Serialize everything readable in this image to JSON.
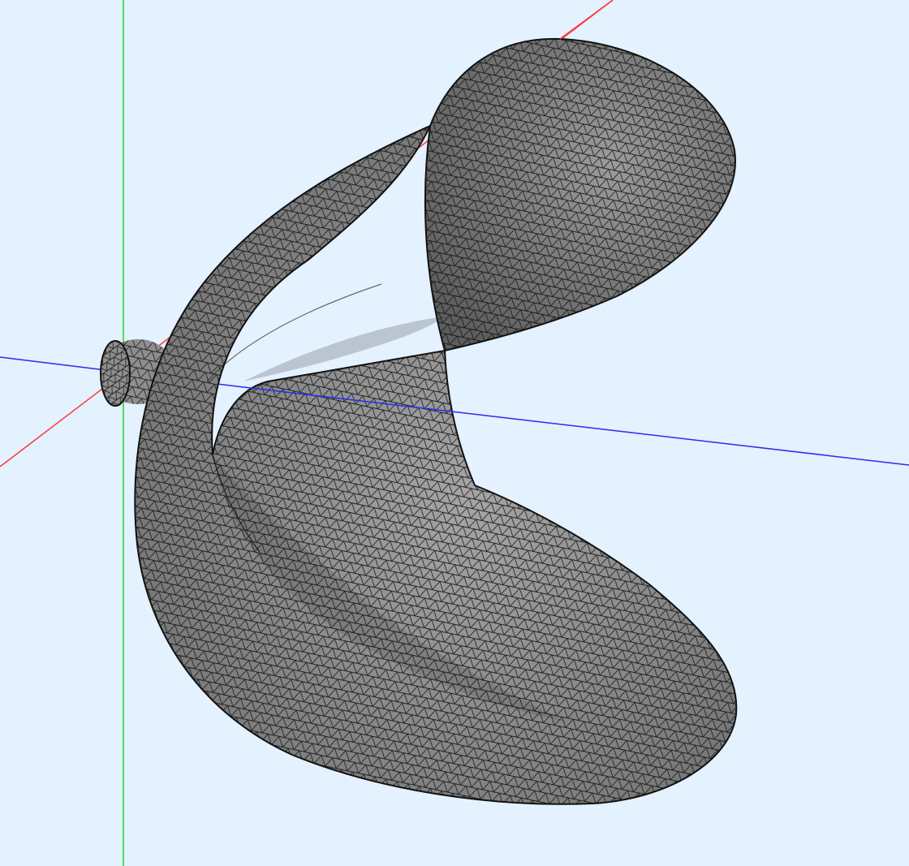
{
  "scene": {
    "background_color": "#e4f1ff",
    "mesh_fill_color": "#8e8e8e",
    "mesh_edge_color": "#111111",
    "axes": [
      {
        "name": "x",
        "color": "#ff3a3a"
      },
      {
        "name": "y",
        "color": "#22d822"
      },
      {
        "name": "z",
        "color": "#2a2af0"
      }
    ],
    "object": "meshed-propeller-blade-with-hub"
  }
}
